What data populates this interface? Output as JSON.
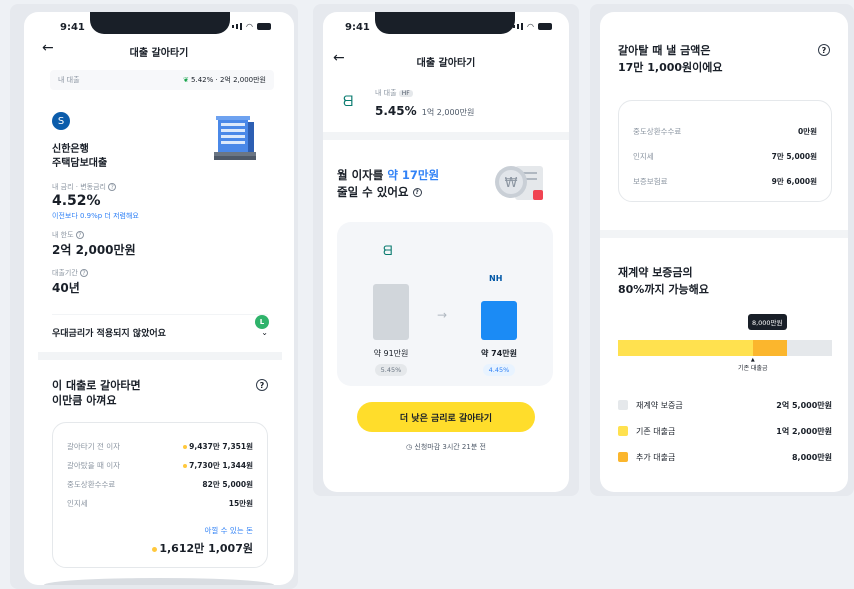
{
  "status": {
    "time": "9:41"
  },
  "screen1": {
    "nav_title": "대출 갈아타기",
    "my_loan_label": "내 대출",
    "my_loan_value": "5.42% · 2억 2,000만원",
    "bank": "신한은행",
    "product": "주택담보대출",
    "rate_label": "내 금리 · 변동금리",
    "rate_value": "4.52%",
    "rate_note": "이전보다 0.9%p 더 저렴해요",
    "limit_label": "내 한도",
    "limit_value": "2억 2,000만원",
    "term_label": "대출기간",
    "term_value": "40년",
    "preferential_text": "우대금리가 적용되지 않았어요",
    "badge_letter": "L",
    "save_title_1": "이 대출로 갈아타면",
    "save_title_2": "이만큼 아껴요",
    "rows": [
      {
        "label": "갈아타기 전 이자",
        "value": "9,437만 7,351원"
      },
      {
        "label": "갈아탔을 때 이자",
        "value": "7,730만 1,344원"
      },
      {
        "label": "중도상환수수료",
        "value": "82만 5,000원"
      },
      {
        "label": "인지세",
        "value": "15만원"
      }
    ],
    "savable_label": "아낄 수 있는 돈",
    "savable_value": "1,612만 1,007원"
  },
  "screen2": {
    "nav_title": "대출 갈아타기",
    "my_loan_label": "내 대출",
    "tag": "HF",
    "rate": "5.45%",
    "amount": "1억 2,000만원",
    "headline_pre": "월 이자를 ",
    "headline_hl": "약 17만원",
    "headline_2": "줄일 수 있어요",
    "nh_label": "NH",
    "left_amount": "약 91만원",
    "left_rate": "5.45%",
    "right_amount": "약 74만원",
    "right_rate": "4.45%",
    "left_bar_fraction": 1.0,
    "right_bar_fraction": 0.69,
    "cta": "더 낮은 금리로 갈아타기",
    "deadline": "신청마감 3시간 21분 전"
  },
  "screen3": {
    "title_1": "갈아탈 때 낼 금액은",
    "title_2": "17만 1,000원이에요",
    "rows": [
      {
        "label": "중도상환수수료",
        "value": "0만원"
      },
      {
        "label": "인지세",
        "value": "7만 5,000원"
      },
      {
        "label": "보증보험료",
        "value": "9만 6,000원"
      }
    ],
    "deposit_title_1": "재계약 보증금의",
    "deposit_title_2": "80%까지 가능해요",
    "tooltip": "8,000만원",
    "marker_label": "기존 대출금",
    "bar_existing_fraction": 0.63,
    "bar_additional_fraction": 0.16,
    "legend": [
      {
        "label": "재계약 보증금",
        "value": "2억 5,000만원",
        "color": "#e5e8eb"
      },
      {
        "label": "기존 대출금",
        "value": "1억 2,000만원",
        "color": "#ffe14f"
      },
      {
        "label": "추가 대출금",
        "value": "8,000만원",
        "color": "#fbb62d"
      }
    ]
  }
}
